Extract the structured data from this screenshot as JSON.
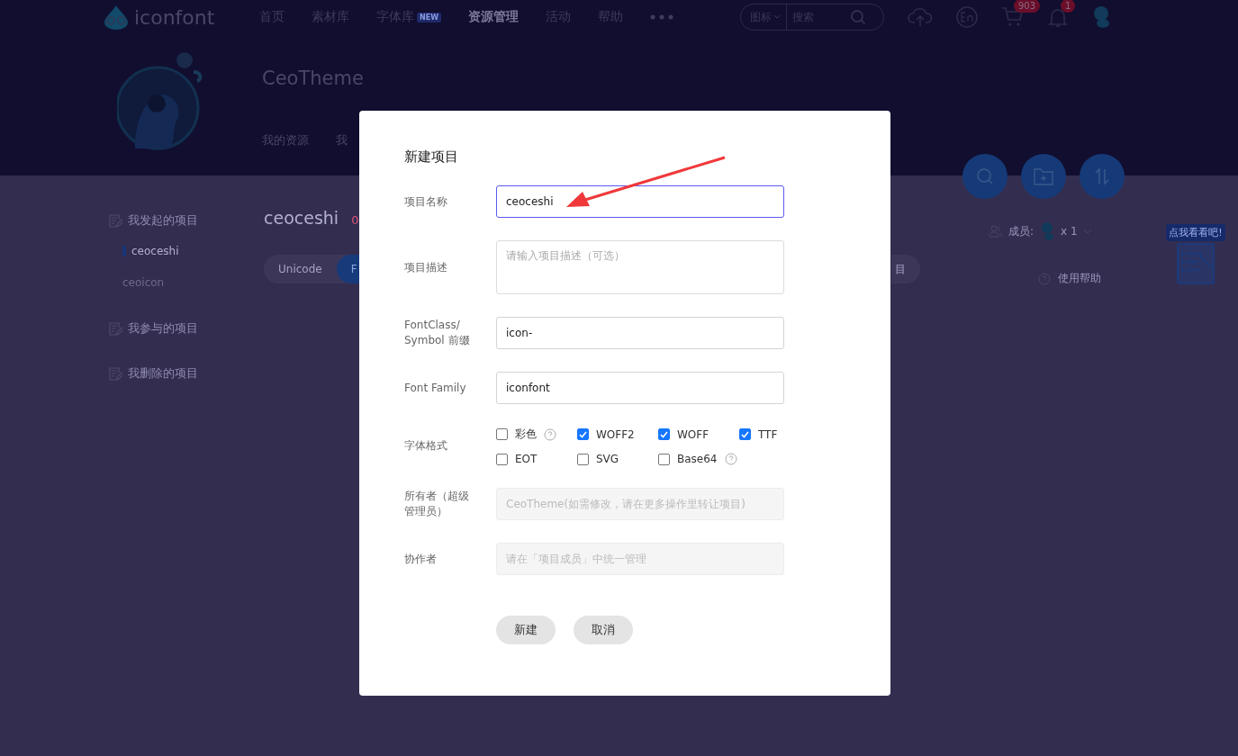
{
  "header": {
    "logo": "iconfont",
    "nav": [
      {
        "label": "首页",
        "selected": false
      },
      {
        "label": "素材库",
        "selected": false
      },
      {
        "label": "字体库",
        "selected": false,
        "badge": "NEW"
      },
      {
        "label": "资源管理",
        "selected": true
      },
      {
        "label": "活动",
        "selected": false
      },
      {
        "label": "帮助",
        "selected": false
      }
    ],
    "search": {
      "scope": "图标",
      "placeholder": "搜索"
    },
    "cart_badge": "903",
    "bell_badge": "1"
  },
  "profile": {
    "name": "CeoTheme",
    "tabs": [
      "我的资源",
      "我"
    ]
  },
  "sidebar": [
    {
      "label": "我发起的项目",
      "children": [
        {
          "label": "ceoceshi",
          "selected": true
        },
        {
          "label": "ceoicon",
          "selected": false
        }
      ]
    },
    {
      "label": "我参与的项目"
    },
    {
      "label": "我删除的项目"
    }
  ],
  "project": {
    "title": "ceoceshi",
    "count": "0",
    "tabs": [
      {
        "label": "Unicode",
        "selected": false
      },
      {
        "label": "F",
        "selected": true
      }
    ],
    "tab_tail": "目",
    "members_label": "成员:",
    "members_count": "x 1",
    "help": "使用帮助",
    "widget": "点我看看吧!"
  },
  "dialog": {
    "title": "新建项目",
    "fields": [
      {
        "kind": "input",
        "label": "项目名称",
        "value": "ceoceshi",
        "focused": true,
        "disabled": false
      },
      {
        "kind": "textarea",
        "label": "项目描述",
        "placeholder": "请输入项目描述（可选）"
      },
      {
        "kind": "input",
        "label": "FontClass/ Symbol 前缀",
        "value": "icon-",
        "focused": false,
        "disabled": false
      },
      {
        "kind": "input",
        "label": "Font Family",
        "value": "iconfont",
        "focused": false,
        "disabled": false
      },
      {
        "kind": "formats",
        "label": "字体格式",
        "options": [
          {
            "label": "彩色",
            "checked": false,
            "help": true
          },
          {
            "label": "WOFF2",
            "checked": true,
            "help": false
          },
          {
            "label": "WOFF",
            "checked": true,
            "help": false
          },
          {
            "label": "TTF",
            "checked": true,
            "help": false
          },
          {
            "label": "EOT",
            "checked": false,
            "help": false
          },
          {
            "label": "SVG",
            "checked": false,
            "help": false
          },
          {
            "label": "Base64",
            "checked": false,
            "help": true
          }
        ]
      },
      {
        "kind": "input",
        "label": "所有者（超级管理员）",
        "placeholder": "CeoTheme(如需修改，请在更多操作里转让项目)",
        "focused": false,
        "disabled": true
      },
      {
        "kind": "input",
        "label": "协作者",
        "placeholder": "请在「项目成员」中统一管理",
        "focused": false,
        "disabled": true
      }
    ],
    "buttons": [
      "新建",
      "取消"
    ]
  }
}
